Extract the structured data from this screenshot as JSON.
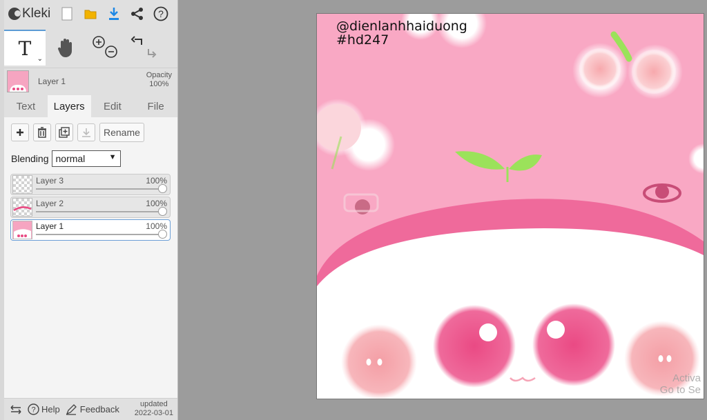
{
  "app": {
    "name": "Kleki"
  },
  "toolbar": {
    "icons": [
      "new-file-icon",
      "open-folder-icon",
      "download-icon",
      "share-icon",
      "help-icon"
    ],
    "colors": {
      "folder": "#f2b300",
      "download": "#1e88e5"
    }
  },
  "tools": {
    "text_tool_label": "T",
    "icons": [
      "hand-icon",
      "zoom-in-icon",
      "zoom-out-icon",
      "undo-icon",
      "redo-icon"
    ]
  },
  "current_layer": {
    "name": "Layer 1",
    "opacity_label": "Opacity",
    "opacity_value": "100%"
  },
  "tabs": [
    {
      "label": "Text",
      "active": false
    },
    {
      "label": "Layers",
      "active": true
    },
    {
      "label": "Edit",
      "active": false
    },
    {
      "label": "File",
      "active": false
    }
  ],
  "layers_panel": {
    "rename_label": "Rename",
    "blending_label": "Blending",
    "blending_value": "normal",
    "layers": [
      {
        "name": "Layer 3",
        "opacity": "100%",
        "selected": false
      },
      {
        "name": "Layer 2",
        "opacity": "100%",
        "selected": false
      },
      {
        "name": "Layer 1",
        "opacity": "100%",
        "selected": true
      }
    ]
  },
  "footer": {
    "help_label": "Help",
    "feedback_label": "Feedback",
    "updated_label": "updated",
    "updated_date": "2022-03-01"
  },
  "canvas": {
    "watermark_line1": "@dienlanhhaiduong",
    "watermark_line2": "#hd247",
    "activate_line1": "Activa",
    "activate_line2": "Go to Se",
    "colors": {
      "background": "#f9a8c4",
      "band": "#ef6a9b",
      "face": "#ffffff",
      "cheek": "#ef5a8e",
      "leaf": "#9be25a"
    }
  }
}
